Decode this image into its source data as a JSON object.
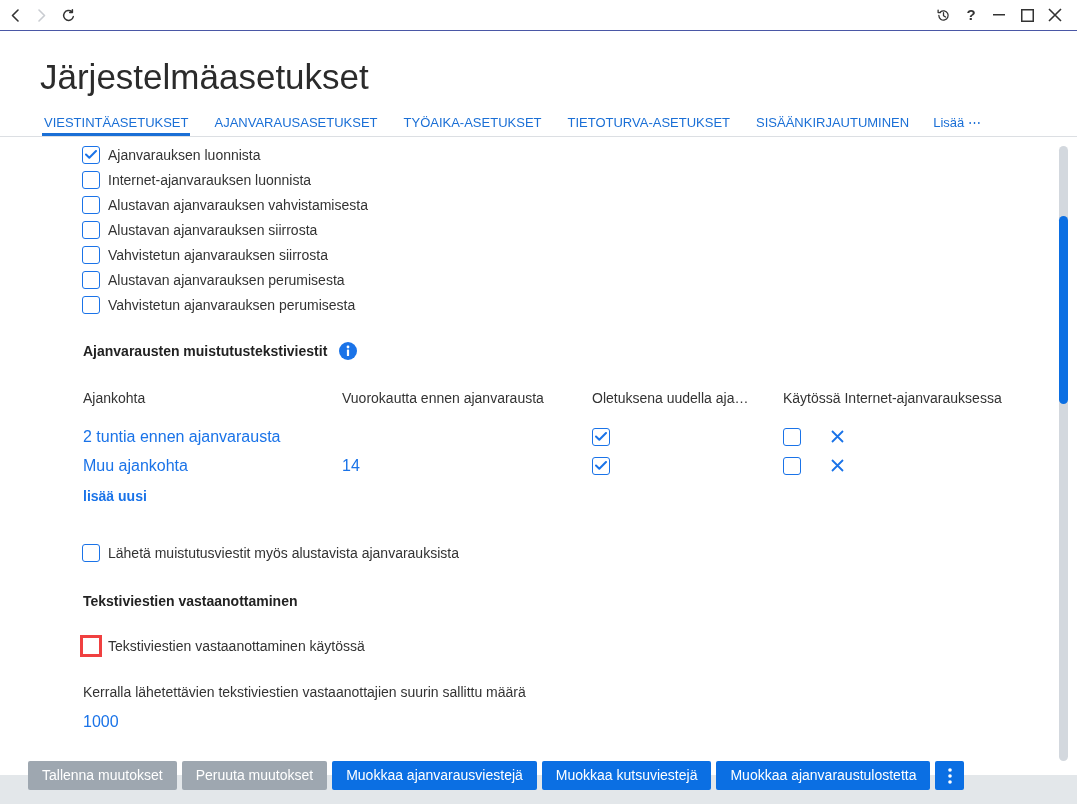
{
  "title_bar": {
    "navigation": [
      {
        "kind": "back",
        "disabled": false
      },
      {
        "kind": "forward",
        "disabled": true
      },
      {
        "kind": "refresh",
        "disabled": false
      }
    ],
    "help": "?"
  },
  "title": "Järjestelmäasetukset",
  "tabs": [
    {
      "label": "VIESTINTÄASETUKSET",
      "selected": true
    },
    {
      "label": "AJANVARAUSASETUKSET",
      "selected": false
    },
    {
      "label": "TYÖAIKA-ASETUKSET",
      "selected": false
    },
    {
      "label": "TIETOTURVA-ASETUKSET",
      "selected": false
    },
    {
      "label": "SISÄÄNKIRJAUTUMINEN",
      "selected": false
    }
  ],
  "more_tabs": "Lisää ⋯",
  "notification_options": [
    {
      "label": "Ajanvarauksen luonnista",
      "checked": true
    },
    {
      "label": "Internet-ajanvarauksen luonnista",
      "checked": false
    },
    {
      "label": "Alustavan ajanvarauksen vahvistamisesta",
      "checked": false
    },
    {
      "label": "Alustavan ajanvarauksen siirrosta",
      "checked": false
    },
    {
      "label": "Vahvistetun ajanvarauksen siirrosta",
      "checked": false
    },
    {
      "label": "Alustavan ajanvarauksen perumisesta",
      "checked": false
    },
    {
      "label": "Vahvistetun ajanvarauksen perumisesta",
      "checked": false
    }
  ],
  "reminders": {
    "heading": "Ajanvarausten muistutustekstiviestit",
    "columns": [
      "Ajankohta",
      "Vuorokautta ennen ajanvarausta",
      "Oletuksena uudella aja…",
      "Käytössä Internet-ajanvarauksessa"
    ],
    "rows": [
      {
        "time": "2 tuntia ennen ajanvarausta",
        "default_for_new": true,
        "internet": false
      },
      {
        "time": "Muu ajankohta",
        "days": "14",
        "default_for_new": true,
        "internet": false
      }
    ],
    "add_link": "lisää uusi"
  },
  "send_preliminary": {
    "label": "Lähetä muistutusviestit myös alustavista ajanvarauksista",
    "checked": false
  },
  "receiving": {
    "heading": "Tekstiviestien vastaanottaminen",
    "enabled": {
      "label": "Tekstiviestien vastaanottaminen käytössä",
      "checked": false,
      "highlighted": true
    },
    "max_recipients_label": "Kerralla lähetettävien tekstiviestien vastaanottajien suurin sallittu määrä",
    "max_recipients_value": "1000"
  },
  "buttons": [
    {
      "label": "Tallenna muutokset",
      "disabled": true
    },
    {
      "label": "Peruuta muutokset",
      "disabled": true
    },
    {
      "label": "Muokkaa ajanvarausviestejä",
      "disabled": false
    },
    {
      "label": "Muokkaa kutsuviestejä",
      "disabled": false
    },
    {
      "label": "Muokkaa ajanvaraustulostetta",
      "disabled": false
    }
  ]
}
